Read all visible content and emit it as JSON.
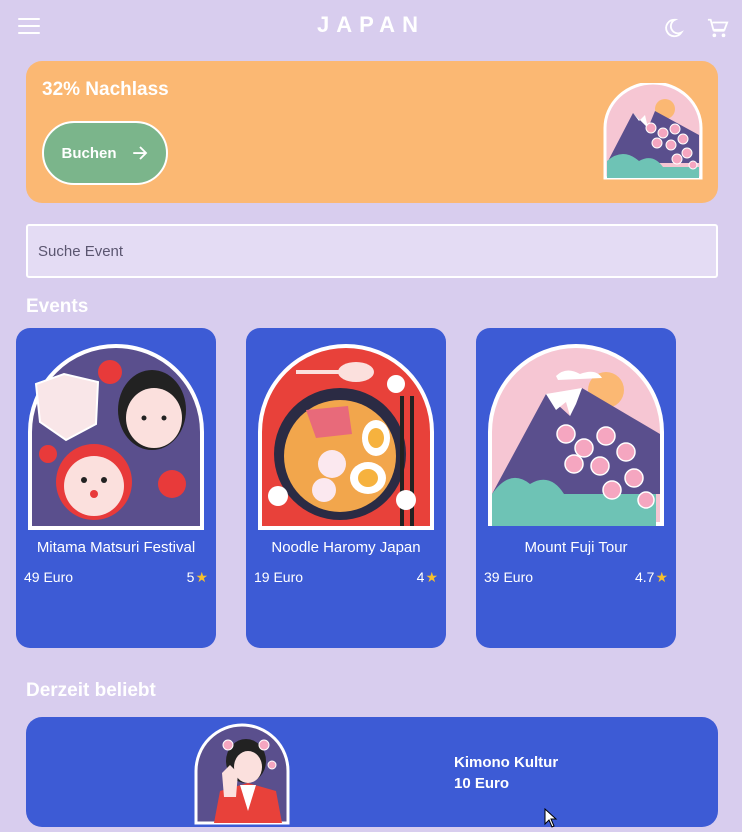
{
  "appbar": {
    "title": "JAPAN"
  },
  "promo": {
    "title": "32% Nachlass",
    "button_label": "Buchen"
  },
  "search": {
    "placeholder": "Suche Event"
  },
  "events": {
    "title": "Events",
    "items": [
      {
        "name": "Mitama Matsuri Festival",
        "price": "49 Euro",
        "rating": "5"
      },
      {
        "name": "Noodle Haromy Japan",
        "price": "19 Euro",
        "rating": "4"
      },
      {
        "name": "Mount Fuji Tour",
        "price": "39 Euro",
        "rating": "4.7"
      }
    ]
  },
  "popular": {
    "title": "Derzeit beliebt",
    "item": {
      "name": "Kimono Kultur",
      "price": "10 Euro"
    }
  },
  "colors": {
    "background": "#d8cdee",
    "promo": "#fbb873",
    "button": "#7bb58b",
    "card": "#3d5bd5",
    "star": "#f7bf2e"
  },
  "icons": [
    "menu-icon",
    "moon-icon",
    "cart-icon",
    "arrow-right-icon",
    "star-icon",
    "mouse-cursor-icon"
  ]
}
